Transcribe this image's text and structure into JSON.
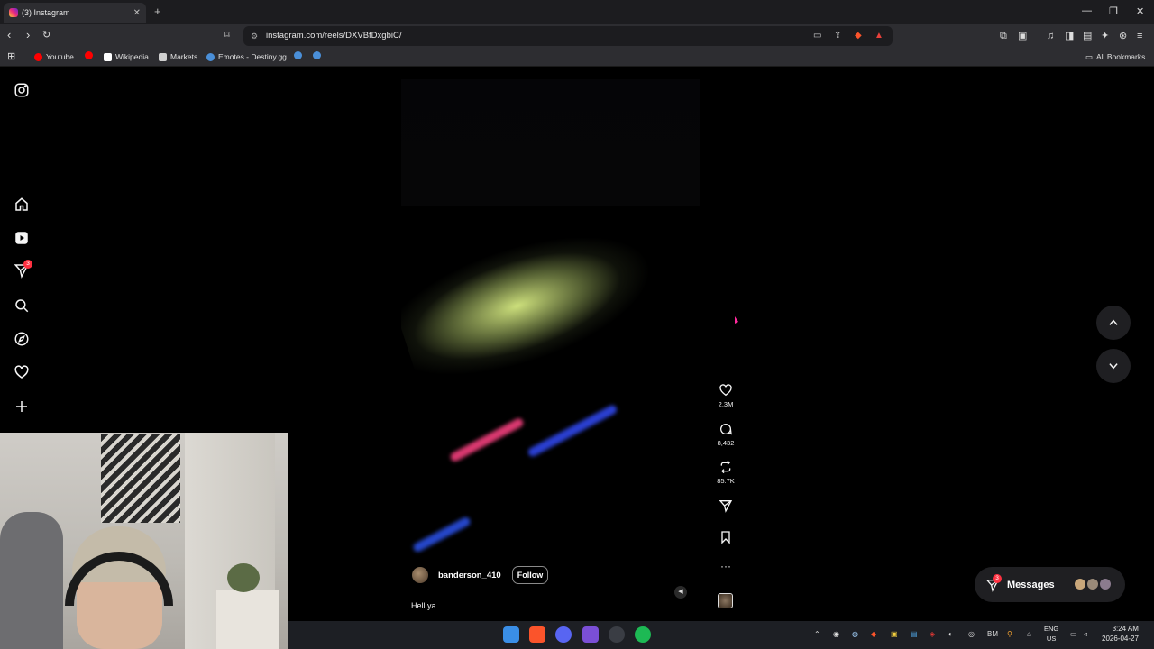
{
  "browser": {
    "tab_title": "(3) Instagram",
    "tab_close": "✕",
    "new_tab": "+",
    "url": "instagram.com/reels/DXVBfDxgbiC/",
    "bookmarks": [
      "Youtube",
      "Wikipedia",
      "Markets",
      "Emotes - Destiny.gg"
    ],
    "all_bookmarks": "All Bookmarks"
  },
  "sidebar": {
    "notifications_badge": "3"
  },
  "reel": {
    "username": "banderson_410",
    "follow_label": "Follow",
    "caption": "Hell ya",
    "likes": "2.3M",
    "comments": "8,432",
    "reposts": "85.7K",
    "more": "···"
  },
  "messages": {
    "label": "Messages",
    "badge": "3"
  },
  "taskbar": {
    "lang_line1": "ENG",
    "lang_line2": "US",
    "time": "3:24 AM",
    "date": "2026-04-27",
    "tray_bm": "BM"
  },
  "colors": {
    "accent_badge": "#ff3040",
    "page_bg": "#000000",
    "chrome_bg": "#2d2d31"
  }
}
